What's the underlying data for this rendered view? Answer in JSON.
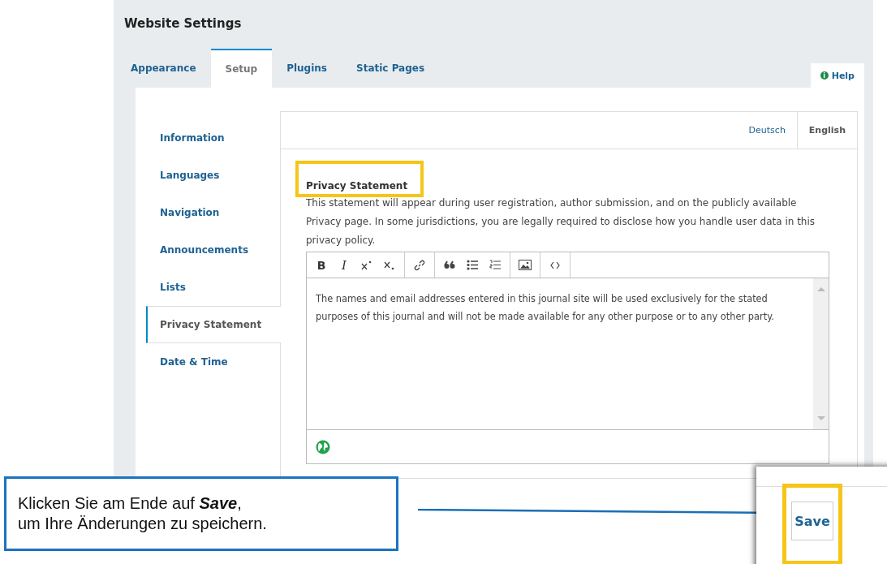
{
  "title": "Website Settings",
  "tabs": [
    {
      "label": "Appearance",
      "selected": false
    },
    {
      "label": "Setup",
      "selected": true
    },
    {
      "label": "Plugins",
      "selected": false
    },
    {
      "label": "Static Pages",
      "selected": false
    }
  ],
  "help": {
    "icon": "i",
    "label": "Help"
  },
  "sidebar": {
    "items": [
      {
        "label": "Information",
        "selected": false
      },
      {
        "label": "Languages",
        "selected": false
      },
      {
        "label": "Navigation",
        "selected": false
      },
      {
        "label": "Announcements",
        "selected": false
      },
      {
        "label": "Lists",
        "selected": false
      },
      {
        "label": "Privacy Statement",
        "selected": true
      },
      {
        "label": "Date & Time",
        "selected": false
      }
    ]
  },
  "locales": [
    {
      "label": "Deutsch",
      "selected": false
    },
    {
      "label": "English",
      "selected": true
    }
  ],
  "field": {
    "label": "Privacy Statement",
    "label_highlighted": true,
    "description": "This statement will appear during user registration, author submission, and on the publicly available Privacy page. In some jurisdictions, you are legally required to disclose how you handle user data in this privacy policy.",
    "toolbar": [
      [
        {
          "kind": "bold",
          "label": "B"
        },
        {
          "kind": "italic",
          "label": "I"
        },
        {
          "kind": "superscript"
        },
        {
          "kind": "subscript"
        }
      ],
      [
        {
          "kind": "link"
        }
      ],
      [
        {
          "kind": "quote"
        },
        {
          "kind": "bullets"
        },
        {
          "kind": "numbers"
        }
      ],
      [
        {
          "kind": "image"
        }
      ],
      [
        {
          "kind": "code"
        }
      ]
    ],
    "value": "The names and email addresses entered in this journal site will be used exclusively for the stated purposes of this journal and will not be made available for any other purpose or to any other party."
  },
  "callout": {
    "lines": [
      "Klicken Sie am Ende auf **Save**,",
      "um Ihre Änderungen zu speichern."
    ]
  },
  "save_button": {
    "label": "Save",
    "highlighted": true
  }
}
